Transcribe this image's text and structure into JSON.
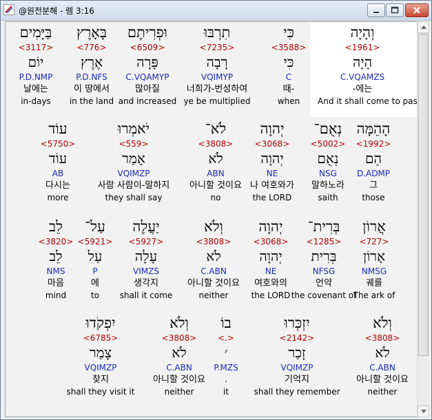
{
  "window": {
    "title": "@원전분해 - 렘 3:16"
  },
  "rows": [
    {
      "words": [
        {
          "hebrew": "וְהָיָה",
          "strong": "<1961>",
          "lemma": "הָיָה",
          "parse": "C.VQAMZS",
          "korean": "-에는",
          "english": "And it shall come to pass"
        },
        {
          "hebrew": "כִּי",
          "strong": "<3588>",
          "lemma": "כִּי",
          "parse": "C",
          "korean": "때-",
          "english": "when"
        },
        {
          "hebrew": "תִרְבּוּ",
          "strong": "<7235>",
          "lemma": "רָבָה",
          "parse": "VQIMYP",
          "korean": "너희가-번성하여",
          "english": "ye be multiplied"
        },
        {
          "hebrew": "וּפְרִיתֶם",
          "strong": "<6509>",
          "lemma": "פָּרָה",
          "parse": "C.VQAMYP",
          "korean": "많아질",
          "english": "and increased"
        },
        {
          "hebrew": "בָּאָרֶץ",
          "strong": "<776>",
          "lemma": "אֶרֶץ",
          "parse": "P.D.NFS",
          "korean": "이 땅에서",
          "english": "in the land"
        },
        {
          "hebrew": "בַּיָּמִים",
          "strong": "<3117>",
          "lemma": "יוֹם",
          "parse": "P.D.NMP",
          "korean": "날에는",
          "english": "in-days"
        }
      ]
    },
    {
      "words": [
        {
          "hebrew": "הָהֵמָּה",
          "strong": "<1992>",
          "lemma": "הֵם",
          "parse": "D.ADMP",
          "korean": "그",
          "english": "those"
        },
        {
          "hebrew": "נְאֻם־",
          "strong": "<5002>",
          "lemma": "נְאֻם",
          "parse": "NSG",
          "korean": "말하노라",
          "english": "saith"
        },
        {
          "hebrew": "יְהוָה",
          "strong": "<3068>",
          "lemma": "יְהוָה",
          "parse": "NE",
          "korean": "나 여호와가",
          "english": "the LORD"
        },
        {
          "hebrew": "לֹא־",
          "strong": "<3808>",
          "lemma": "לֹא",
          "parse": "ABN",
          "korean": "아니할 것이요",
          "english": "no"
        },
        {
          "hebrew": "יֹאמְרוּ",
          "strong": "<559>",
          "lemma": "אָמַר",
          "parse": "VQIMZP",
          "korean": "사람 사람이-말하지",
          "english": "they shall say"
        },
        {
          "hebrew": "עוֹד",
          "strong": "<5750>",
          "lemma": "עוֹד",
          "parse": "AB",
          "korean": "다시는",
          "english": "more"
        }
      ]
    },
    {
      "words": [
        {
          "hebrew": "אֲרוֹן",
          "strong": "<727>",
          "lemma": "אָרוֹן",
          "parse": "NMSG",
          "korean": "궤를",
          "english": "The ark of"
        },
        {
          "hebrew": "בְּרִית־",
          "strong": "<1285>",
          "lemma": "בְּרִית",
          "parse": "NFSG",
          "korean": "언약",
          "english": "the covenant of"
        },
        {
          "hebrew": "יְהוָה",
          "strong": "<3068>",
          "lemma": "יְהוָה",
          "parse": "NE",
          "korean": "여호와의",
          "english": "the LORD"
        },
        {
          "hebrew": "וְלֹא",
          "strong": "<3808>",
          "lemma": "לֹא",
          "parse": "C.ABN",
          "korean": "아니할 것이요",
          "english": "neither"
        },
        {
          "hebrew": "יַעֲלֶה",
          "strong": "<5927>",
          "lemma": "עָלָה",
          "parse": "VIMZS",
          "korean": "생각지",
          "english": "shall it come"
        },
        {
          "hebrew": "עַל־",
          "strong": "<5921>",
          "lemma": "עַל",
          "parse": "P",
          "korean": "에",
          "english": "to"
        },
        {
          "hebrew": "לֵב",
          "strong": "<3820>",
          "lemma": "לֵב",
          "parse": "NMS",
          "korean": "마음",
          "english": "mind"
        }
      ]
    },
    {
      "words": [
        {
          "hebrew": "וְלֹא",
          "strong": "<3808>",
          "lemma": "לֹא",
          "parse": "C.ABN",
          "korean": "아니할 것이요",
          "english": "neither"
        },
        {
          "hebrew": "יִזְכְּרוּ",
          "strong": "<2142>",
          "lemma": "זָכַר",
          "parse": "VQIMZP",
          "korean": "기억지",
          "english": "shall they remember"
        },
        {
          "hebrew": "בוֹ",
          "strong": "<.>",
          "lemma": "׳",
          "parse": "P.MZS",
          "korean": ".",
          "english": "it"
        },
        {
          "hebrew": "וְלֹא",
          "strong": "<3808>",
          "lemma": "לֹא",
          "parse": "C.ABN",
          "korean": "아니할 것이요",
          "english": "neither"
        },
        {
          "hebrew": "יִפְקֹדוּ",
          "strong": "<6785>",
          "lemma": "צָמַר",
          "parse": "VQIMZP",
          "korean": "찾지",
          "english": "shall they visit it"
        }
      ]
    }
  ],
  "icons": {
    "app": "app-logo-icon",
    "minimize": "minimize-icon",
    "maximize": "maximize-icon",
    "close": "close-icon"
  }
}
